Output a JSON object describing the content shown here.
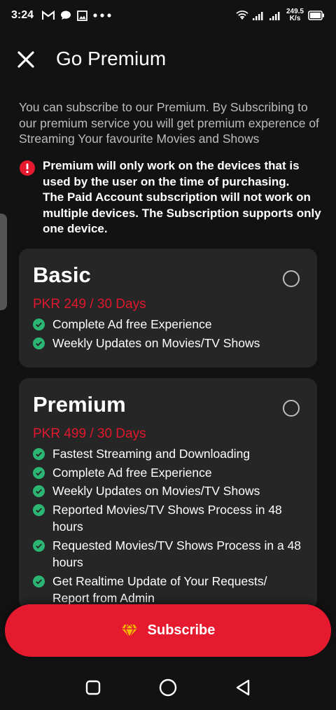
{
  "status_bar": {
    "time": "3:24",
    "net_speed_value": "249.5",
    "net_speed_unit": "K/s",
    "notification_icons": [
      "gmail-icon",
      "chat-icon",
      "gallery-icon",
      "more-dots-icon"
    ]
  },
  "header": {
    "title": "Go Premium"
  },
  "intro_text": "You can subscribe to our Premium. By Subscribing to our premium service you will get premium experence of Streaming Your favourite Movies and Shows",
  "warning_text": "Premium will only work on the devices that is used by the user on the time of purchasing.\nThe Paid Account subscription will not work on multiple devices. The Subscription supports only one device.",
  "plans": [
    {
      "name": "Basic",
      "price": "PKR 249 / 30 Days",
      "features": [
        "Complete Ad free Experience",
        "Weekly Updates on Movies/TV Shows"
      ]
    },
    {
      "name": "Premium",
      "price": "PKR 499 / 30 Days",
      "features": [
        "Fastest Streaming and Downloading",
        "Complete Ad free Experience",
        "Weekly Updates on Movies/TV Shows",
        "Reported Movies/TV Shows Process in 48 hours",
        "Requested Movies/TV Shows Process in a 48 hours",
        "Get Realtime Update of Your Requests/ Report from Admin"
      ]
    }
  ],
  "subscribe_label": "Subscribe",
  "colors": {
    "background": "#121212",
    "card": "#262626",
    "accent_red": "#e51a2e",
    "price_red": "#e0182d",
    "check_green": "#2bb673",
    "diamond_yellow": "#f5b800"
  }
}
